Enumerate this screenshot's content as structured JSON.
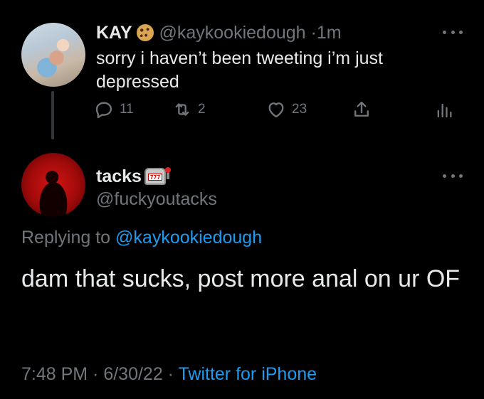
{
  "parent_tweet": {
    "display_name": "KAY",
    "name_emoji": "cookie-emoji",
    "handle": "@kaykookiedough",
    "separator": "·",
    "time": "1m",
    "text": "sorry i haven’t been tweeting i’m just depressed",
    "actions": {
      "reply_count": "11",
      "retweet_count": "2",
      "like_count": "23"
    }
  },
  "reply_tweet": {
    "display_name": "tacks",
    "name_emoji": "slot-machine-emoji",
    "slot_digits": "777",
    "handle": "@fuckyoutacks",
    "replying_prefix": "Replying to",
    "replying_to": "@kaykookiedough",
    "text": "dam that sucks, post more anal on ur OF",
    "timestamp": "7:48 PM · 6/30/22 ·",
    "source": "Twitter for iPhone"
  },
  "colors": {
    "background": "#000000",
    "primary_text": "#e7e9ea",
    "secondary_text": "#71767b",
    "link": "#1d9bf0"
  }
}
